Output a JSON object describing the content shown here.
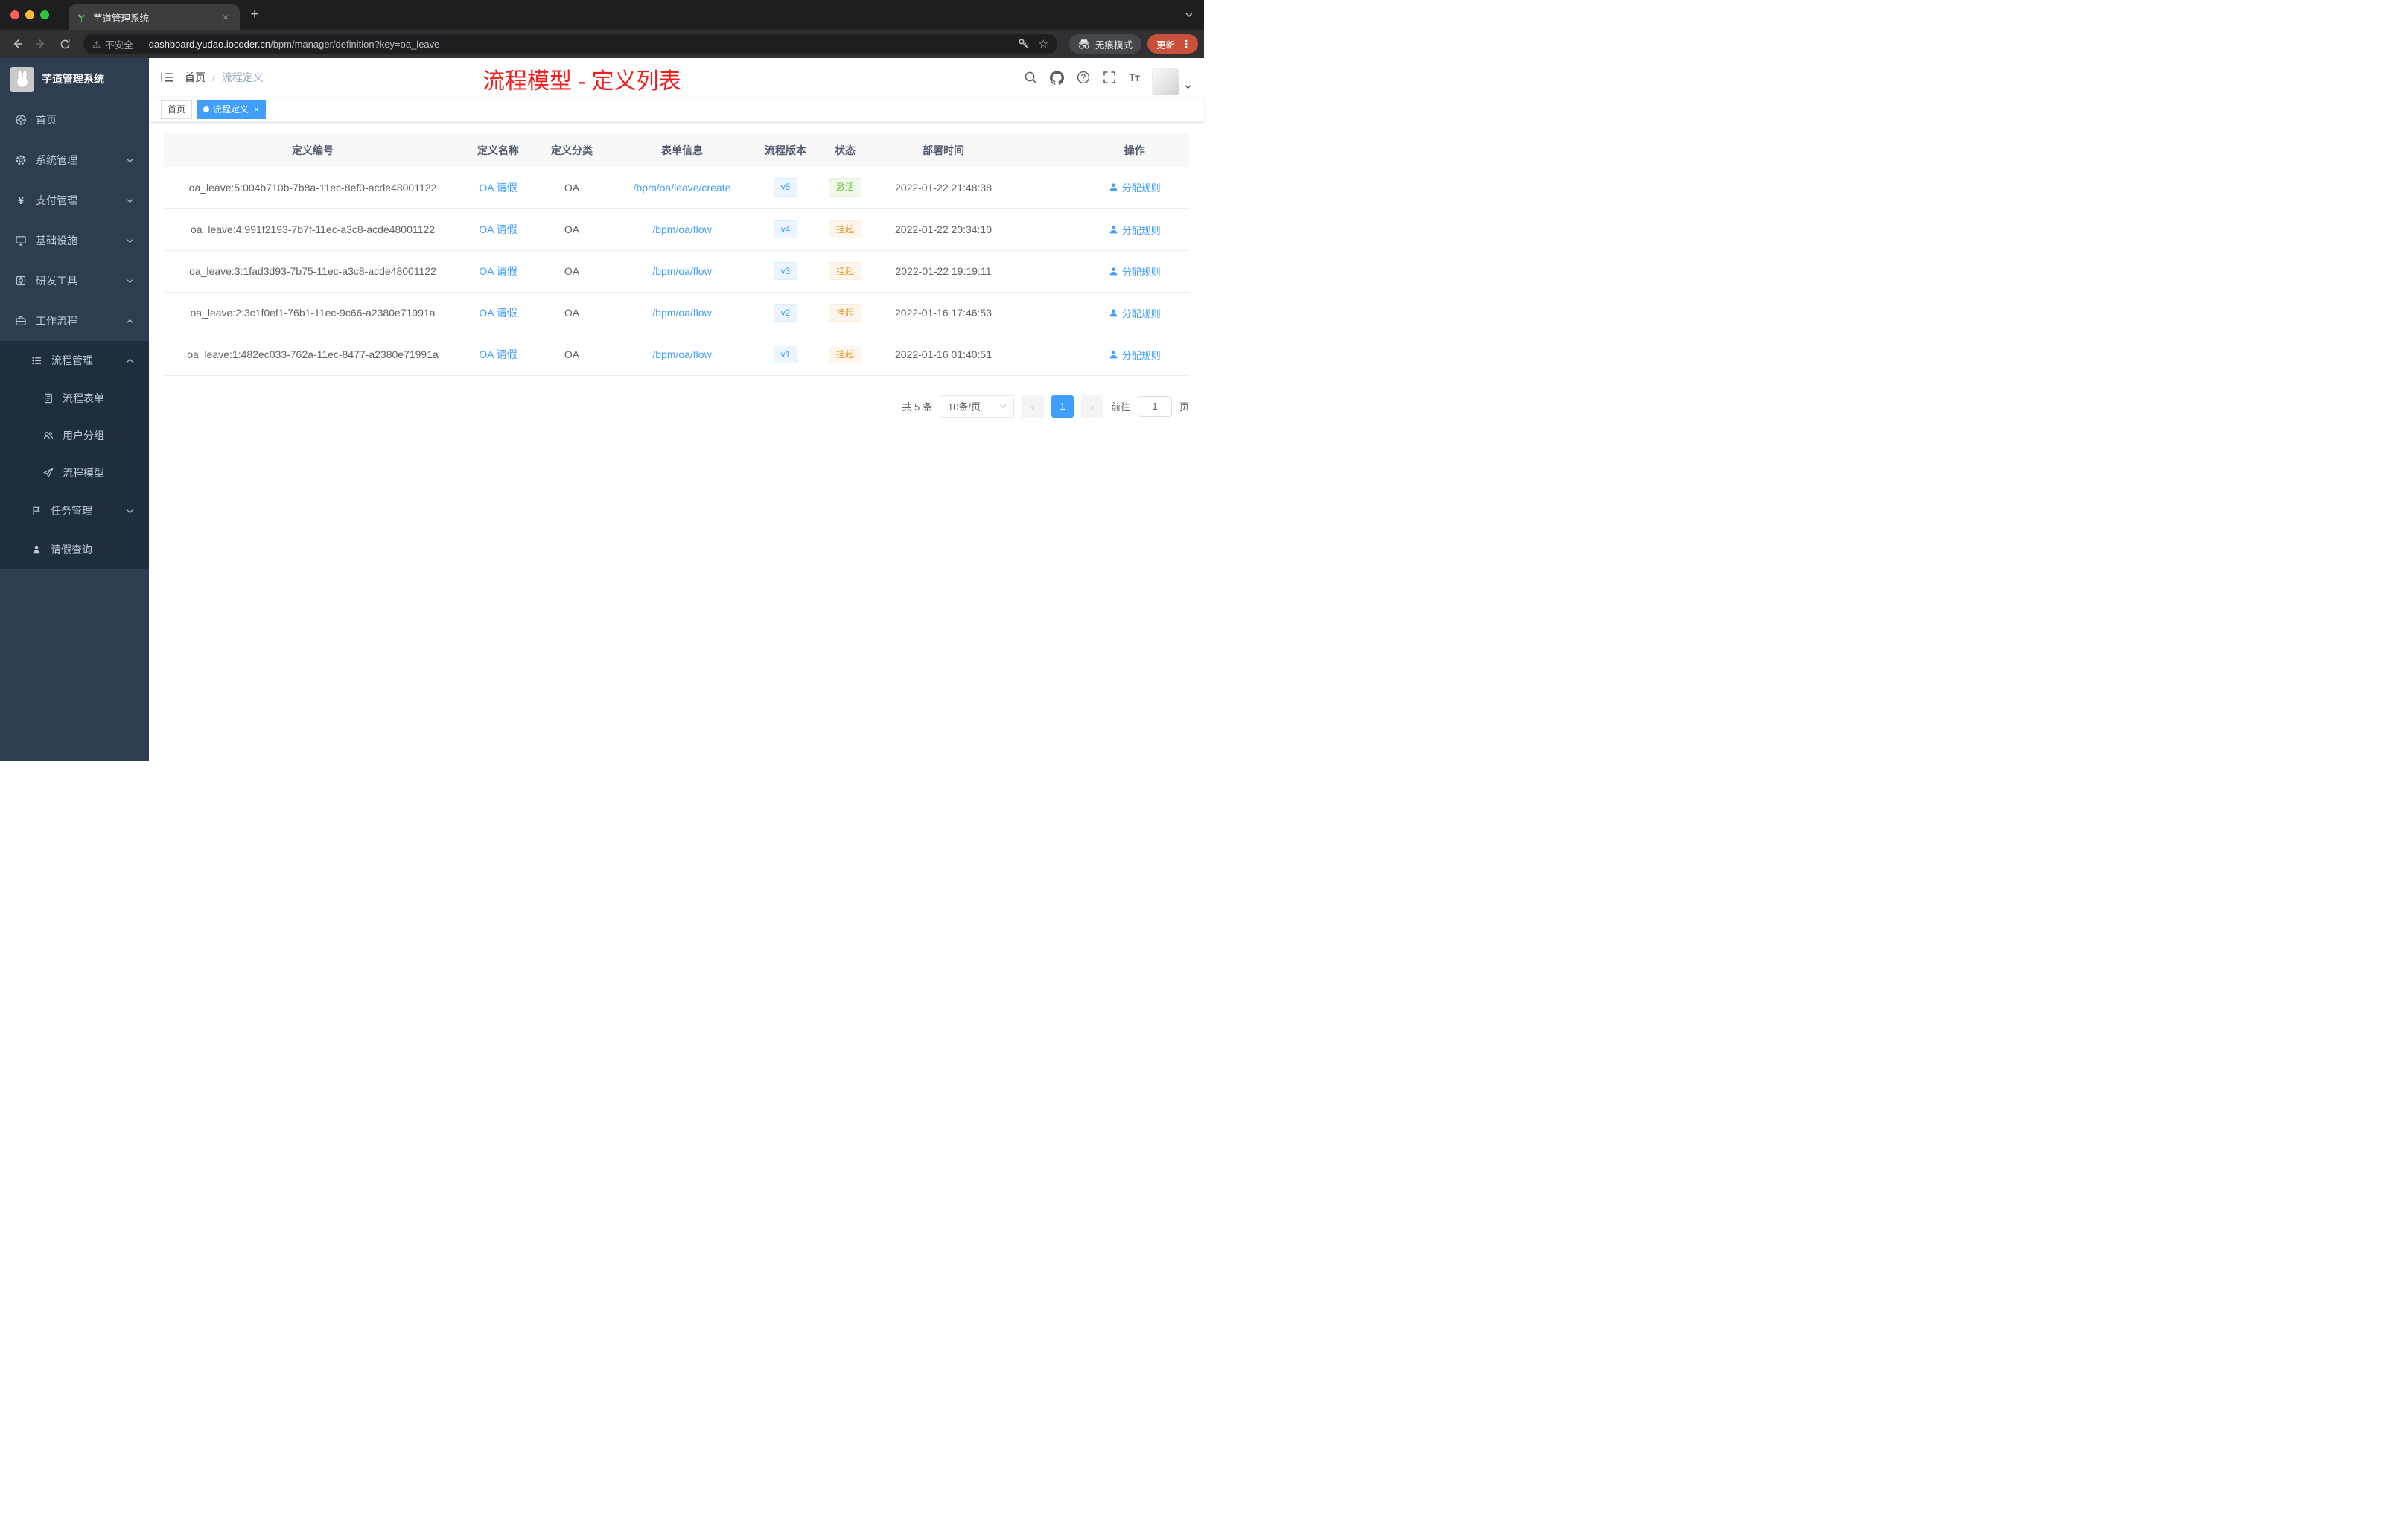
{
  "browser": {
    "tab_title": "芋道管理系统",
    "security_label": "不安全",
    "url_host": "dashboard.yudao.iocoder.cn",
    "url_path": "/bpm/manager/definition?key=oa_leave",
    "incognito_label": "无痕模式",
    "update_label": "更新"
  },
  "glyphs": {
    "warning": "⚠",
    "star": "☆",
    "kebab": "⋮",
    "close": "×",
    "plus": "+",
    "prev": "‹",
    "next": "›",
    "slash": "/"
  },
  "sidebar": {
    "logo_title": "芋道管理系统",
    "menu_home": "首页",
    "menu_system": "系统管理",
    "menu_pay": "支付管理",
    "menu_infra": "基础设施",
    "menu_dev": "研发工具",
    "menu_workflow": "工作流程",
    "menu_process_mgmt": "流程管理",
    "menu_process_form": "流程表单",
    "menu_user_group": "用户分组",
    "menu_process_model": "流程模型",
    "menu_task_mgmt": "任务管理",
    "menu_leave_query": "请假查询"
  },
  "header": {
    "breadcrumb_home": "首页",
    "breadcrumb_current": "流程定义",
    "annotation": "流程模型 - 定义列表"
  },
  "tags": {
    "home": "首页",
    "active": "流程定义"
  },
  "table": {
    "columns": [
      "定义编号",
      "定义名称",
      "定义分类",
      "表单信息",
      "流程版本",
      "状态",
      "部署时间",
      "操作"
    ],
    "rows": [
      {
        "id": "oa_leave:5:004b710b-7b8a-11ec-8ef0-acde48001122",
        "name": "OA 请假",
        "category": "OA",
        "form": "/bpm/oa/leave/create",
        "version": "v5",
        "status": "激活",
        "time": "2022-01-22 21:48:38",
        "action": "分配规则"
      },
      {
        "id": "oa_leave:4:991f2193-7b7f-11ec-a3c8-acde48001122",
        "name": "OA 请假",
        "category": "OA",
        "form": "/bpm/oa/flow",
        "version": "v4",
        "status": "挂起",
        "time": "2022-01-22 20:34:10",
        "action": "分配规则"
      },
      {
        "id": "oa_leave:3:1fad3d93-7b75-11ec-a3c8-acde48001122",
        "name": "OA 请假",
        "category": "OA",
        "form": "/bpm/oa/flow",
        "version": "v3",
        "status": "挂起",
        "time": "2022-01-22 19:19:11",
        "action": "分配规则"
      },
      {
        "id": "oa_leave:2:3c1f0ef1-76b1-11ec-9c66-a2380e71991a",
        "name": "OA 请假",
        "category": "OA",
        "form": "/bpm/oa/flow",
        "version": "v2",
        "status": "挂起",
        "time": "2022-01-16 17:46:53",
        "action": "分配规则"
      },
      {
        "id": "oa_leave:1:482ec033-762a-11ec-8477-a2380e71991a",
        "name": "OA 请假",
        "category": "OA",
        "form": "/bpm/oa/flow",
        "version": "v1",
        "status": "挂起",
        "time": "2022-01-16 01:40:51",
        "action": "分配规则"
      }
    ]
  },
  "pagination": {
    "total": "共 5 条",
    "page_size": "10条/页",
    "page": "1",
    "goto_label": "前往",
    "goto_value": "1",
    "goto_suffix": "页"
  },
  "colors": {
    "primary": "#409eff",
    "success": "#67c23a",
    "warning": "#e6a23c",
    "annotation_red": "#f11c1c",
    "sidebar_bg": "#2f3d50",
    "submenu_bg": "#1f2d3d"
  }
}
